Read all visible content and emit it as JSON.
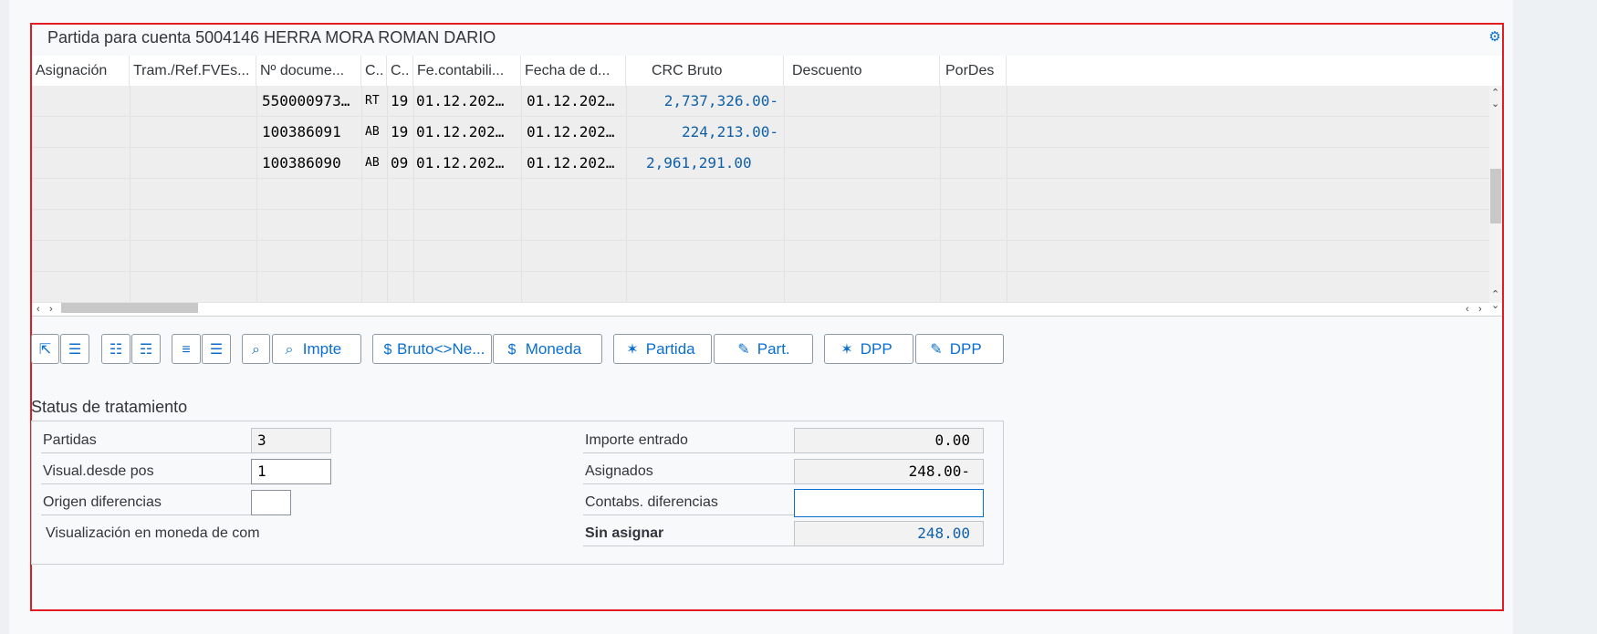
{
  "title": "Partida para cuenta 5004146 HERRA MORA ROMAN DARIO",
  "columns": [
    "Asignación",
    "Tram./Ref.FVEs...",
    "Nº docume...",
    "C..",
    "C..",
    "Fe.contabili...",
    "Fecha de d...",
    "CRC Bruto",
    "Descuento",
    "PorDes"
  ],
  "rows": [
    {
      "asignacion": "",
      "tram": "",
      "doc": "550000973…",
      "c1": "RT",
      "c2": "19",
      "fecont": "01.12.202…",
      "fechad": "01.12.202…",
      "bruto": "2,737,326.00-",
      "descuento": "",
      "pordes": ""
    },
    {
      "asignacion": "",
      "tram": "",
      "doc": "100386091",
      "c1": "AB",
      "c2": "19",
      "fecont": "01.12.202…",
      "fechad": "01.12.202…",
      "bruto": "224,213.00-",
      "descuento": "",
      "pordes": ""
    },
    {
      "asignacion": "",
      "tram": "",
      "doc": "100386090",
      "c1": "AB",
      "c2": "09",
      "fecont": "01.12.202…",
      "fechad": "01.12.202…",
      "bruto": "2,961,291.00",
      "descuento": "",
      "pordes": ""
    }
  ],
  "toolbar": {
    "impte": "Impte",
    "bruto_neto": "Bruto<>Ne...",
    "moneda": "Moneda",
    "partida": "Partida",
    "part": "Part.",
    "dpp1": "DPP",
    "dpp2": "DPP"
  },
  "status": {
    "heading": "Status de tratamiento",
    "partidas_label": "Partidas",
    "partidas_value": "3",
    "visual_label": "Visual.desde pos",
    "visual_value": "1",
    "origen_label": "Origen diferencias",
    "origen_value": "",
    "moneda_com_label": "Visualización en moneda de com",
    "importe_label": "Importe entrado",
    "importe_value": "0.00",
    "asignados_label": "Asignados",
    "asignados_value": "248.00-",
    "contabs_label": "Contabs. diferencias",
    "contabs_value": "",
    "sin_asignar_label": "Sin asignar",
    "sin_asignar_value": "248.00"
  },
  "colors": {
    "frame": "#e31b23",
    "accent": "#0a6ed1",
    "amount": "#1060a8"
  }
}
